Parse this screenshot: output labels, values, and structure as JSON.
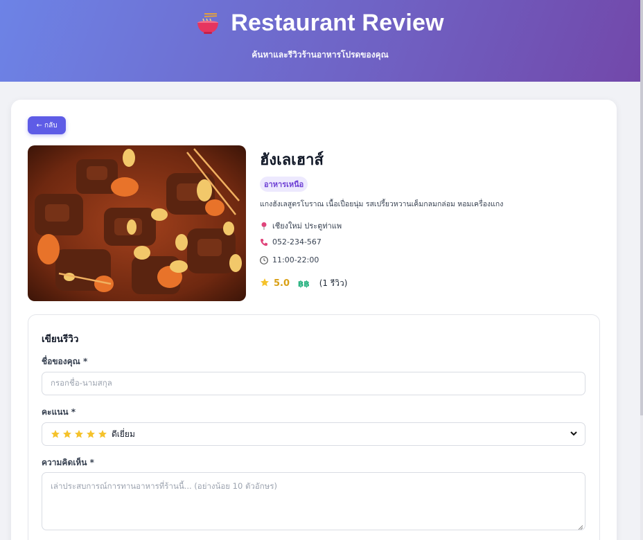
{
  "header": {
    "title": "Restaurant Review",
    "subtitle": "ค้นหาและรีวิวร้านอาหารโปรดของคุณ",
    "logo_icon": "noodle-bowl-icon"
  },
  "back_button": {
    "label": "← กลับ"
  },
  "restaurant": {
    "name": "ฮังเลเฮาส์",
    "category": "อาหารเหนือ",
    "description": "แกงฮังเลสูตรโบราณ เนื้อเปื่อยนุ่ม รสเปรี้ยวหวานเค็มกลมกล่อม หอมเครื่องแกง",
    "location": "เชียงใหม่ ประตูท่าแพ",
    "phone": "052-234-567",
    "hours": "11:00-22:00",
    "rating": "5.0",
    "price_level": "฿฿",
    "review_count": "(1 รีวิว)"
  },
  "review_form": {
    "title": "เขียนรีวิว",
    "name_label": "ชื่อของคุณ *",
    "name_placeholder": "กรอกชื่อ-นามสกุล",
    "rating_label": "คะแนน *",
    "rating_selected": "ดีเยี่ยม",
    "rating_stars": 5,
    "comment_label": "ความคิดเห็น *",
    "comment_placeholder": "เล่าประสบการณ์การทานอาหารที่ร้านนี้... (อย่างน้อย 10 ตัวอักษร)"
  },
  "colors": {
    "header_gradient_start": "#6d83e6",
    "header_gradient_end": "#7248aa",
    "button_primary": "#5e5ce6",
    "tag_bg": "#ede9fe",
    "tag_text": "#6d3fd4",
    "rating_gold": "#d9a016",
    "price_green": "#22b07d"
  }
}
